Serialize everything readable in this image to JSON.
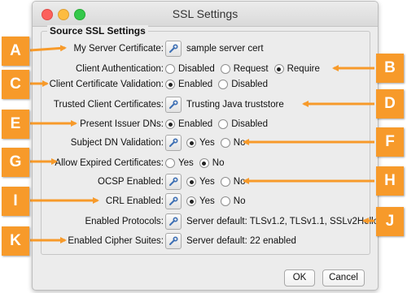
{
  "window": {
    "title": "SSL Settings",
    "group_title": "Source SSL Settings"
  },
  "rows": [
    {
      "label": "My Server Certificate:",
      "value": "sample server cert"
    },
    {
      "label": "Client Authentication:",
      "options": [
        "Disabled",
        "Request",
        "Require"
      ],
      "selected": "Require"
    },
    {
      "label": "Client Certificate Validation:",
      "options": [
        "Enabled",
        "Disabled"
      ],
      "selected": "Enabled"
    },
    {
      "label": "Trusted Client Certificates:",
      "value": "Trusting Java truststore"
    },
    {
      "label": "Present Issuer DNs:",
      "options": [
        "Enabled",
        "Disabled"
      ],
      "selected": "Enabled"
    },
    {
      "label": "Subject DN Validation:",
      "options": [
        "Yes",
        "No"
      ],
      "selected": "Yes"
    },
    {
      "label": "Allow Expired Certificates:",
      "options": [
        "Yes",
        "No"
      ],
      "selected": "No"
    },
    {
      "label": "OCSP Enabled:",
      "options": [
        "Yes",
        "No"
      ],
      "selected": "Yes"
    },
    {
      "label": "CRL Enabled:",
      "options": [
        "Yes",
        "No"
      ],
      "selected": "Yes"
    },
    {
      "label": "Enabled Protocols:",
      "value": "Server default: TLSv1.2, TLSv1.1, SSLv2Hello"
    },
    {
      "label": "Enabled Cipher Suites:",
      "value": "Server default: 22 enabled"
    }
  ],
  "buttons": {
    "ok": "OK",
    "cancel": "Cancel"
  },
  "callouts": [
    "A",
    "B",
    "C",
    "D",
    "E",
    "F",
    "G",
    "H",
    "I",
    "J",
    "K"
  ],
  "colors": {
    "callout": "#f79a2a",
    "window_bg": "#ececec"
  },
  "icons": {
    "config": "wrench-icon"
  }
}
